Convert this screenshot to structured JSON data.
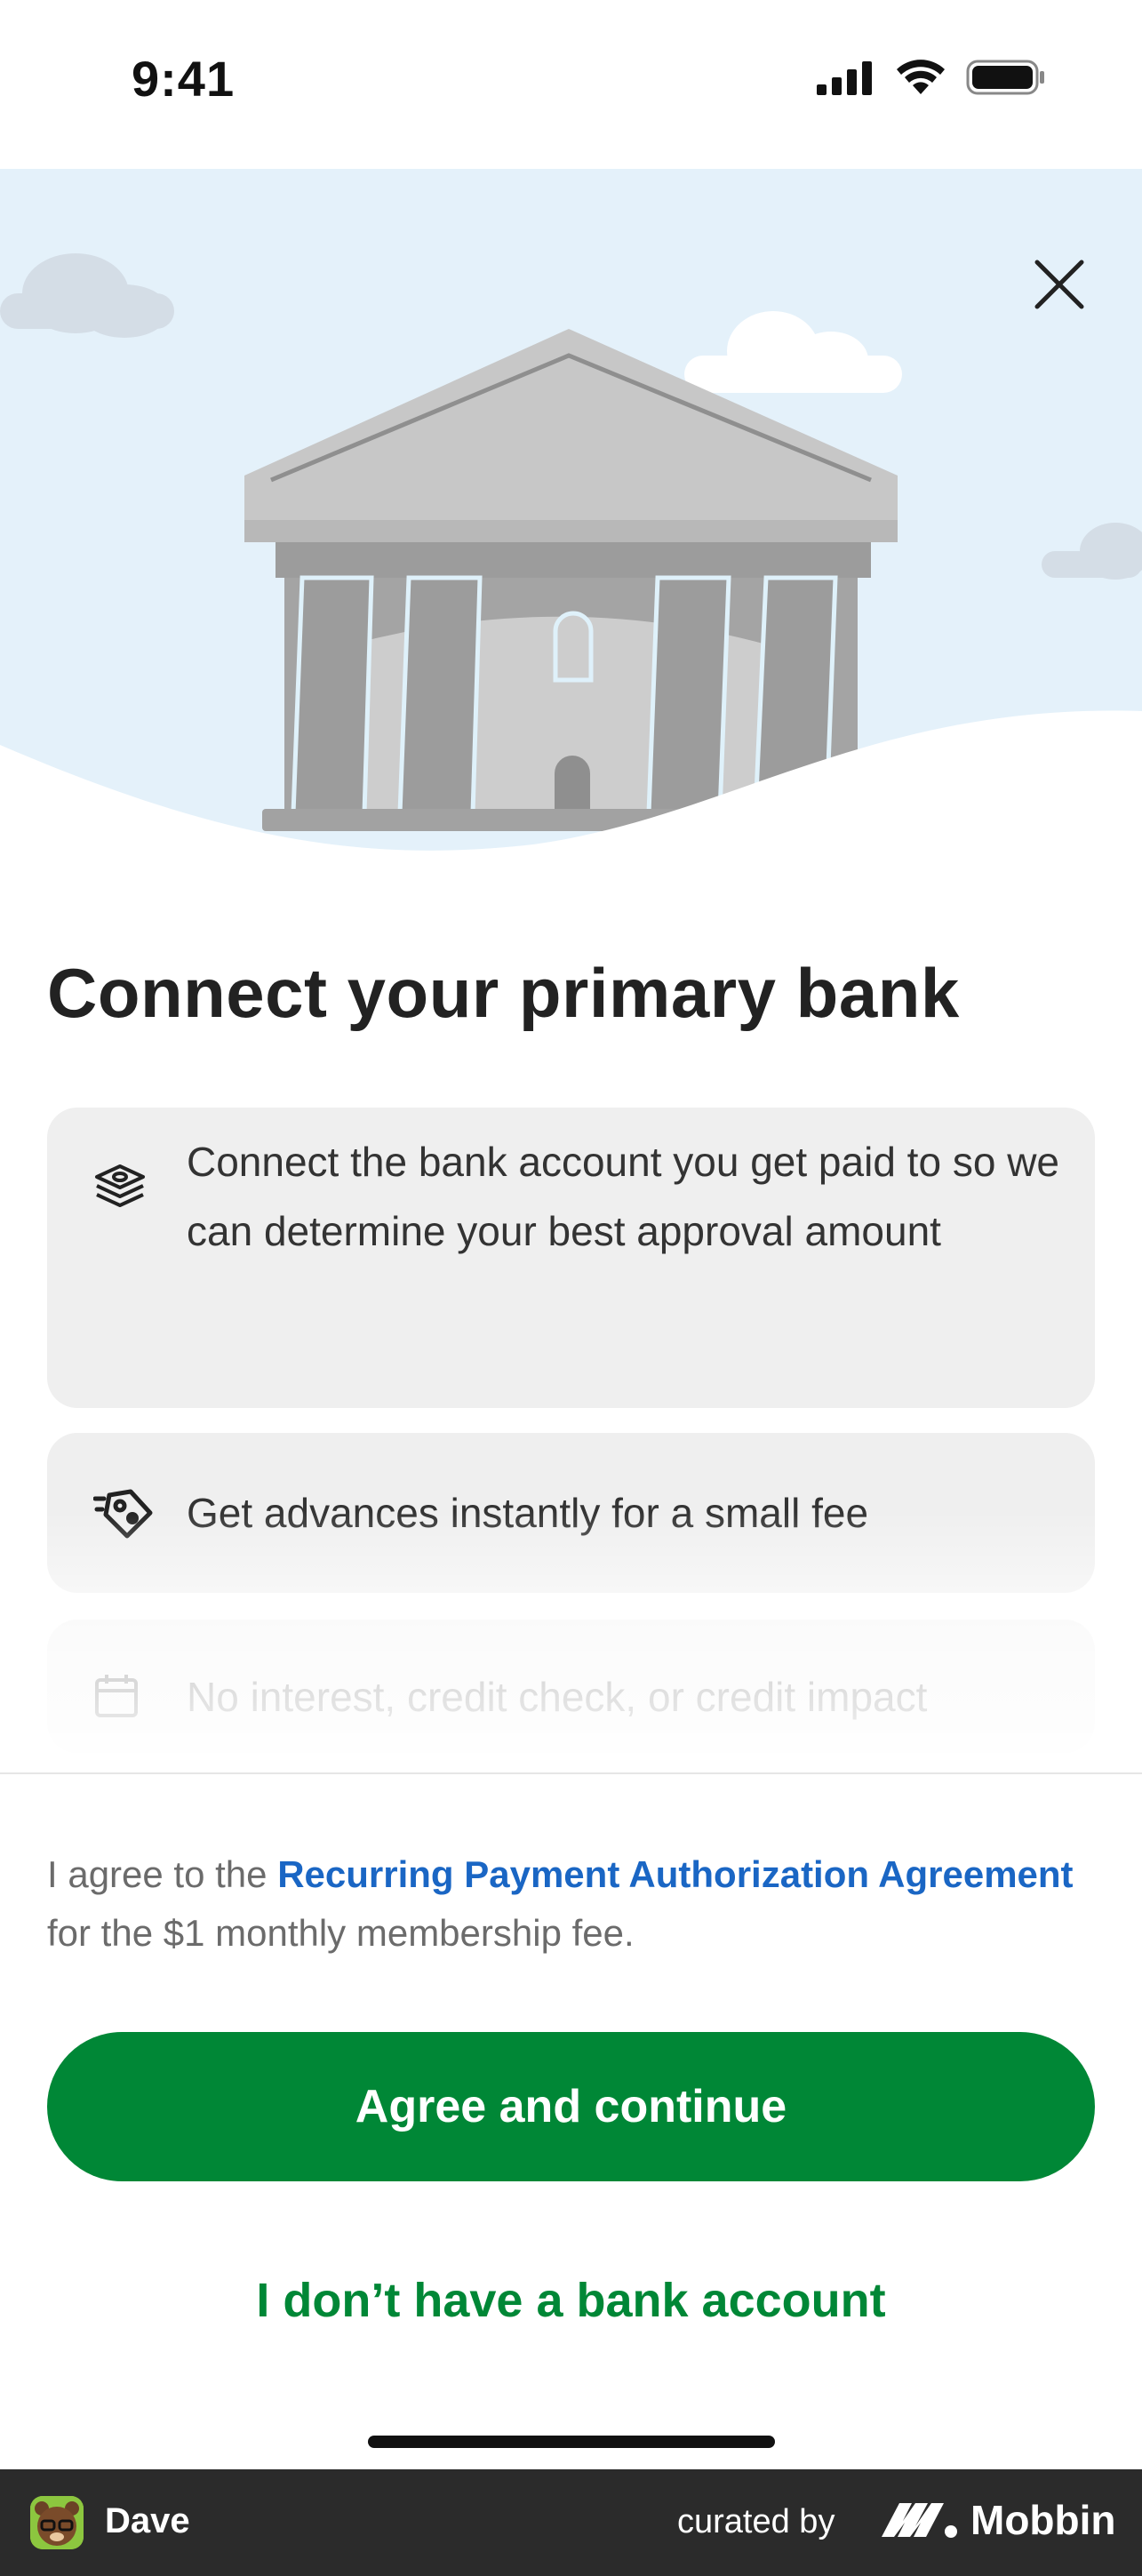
{
  "status_bar": {
    "time": "9:41"
  },
  "hero": {
    "close_icon": "close-icon"
  },
  "title": "Connect your primary bank",
  "features": [
    {
      "icon": "money-stack-icon",
      "text": "Connect the bank account you get paid to so we can determine your best approval amount"
    },
    {
      "icon": "fast-tag-icon",
      "text": "Get advances instantly for a small fee"
    },
    {
      "icon": "calendar-icon",
      "text": "No interest, credit check, or credit impact"
    }
  ],
  "agreement": {
    "prefix": "I agree to the ",
    "link": "Recurring Payment Authorization Agreement",
    "suffix": " for the $1 monthly membership fee."
  },
  "buttons": {
    "primary": "Agree and continue",
    "secondary": "I don’t have a bank account"
  },
  "credit_bar": {
    "app_name": "Dave",
    "curated_by": "curated by",
    "brand": "Mobbin"
  },
  "colors": {
    "primary_green": "#008736",
    "link_blue": "#1a66c4",
    "hero_sky": "#e4f1fa",
    "card_bg": "#efefef"
  }
}
